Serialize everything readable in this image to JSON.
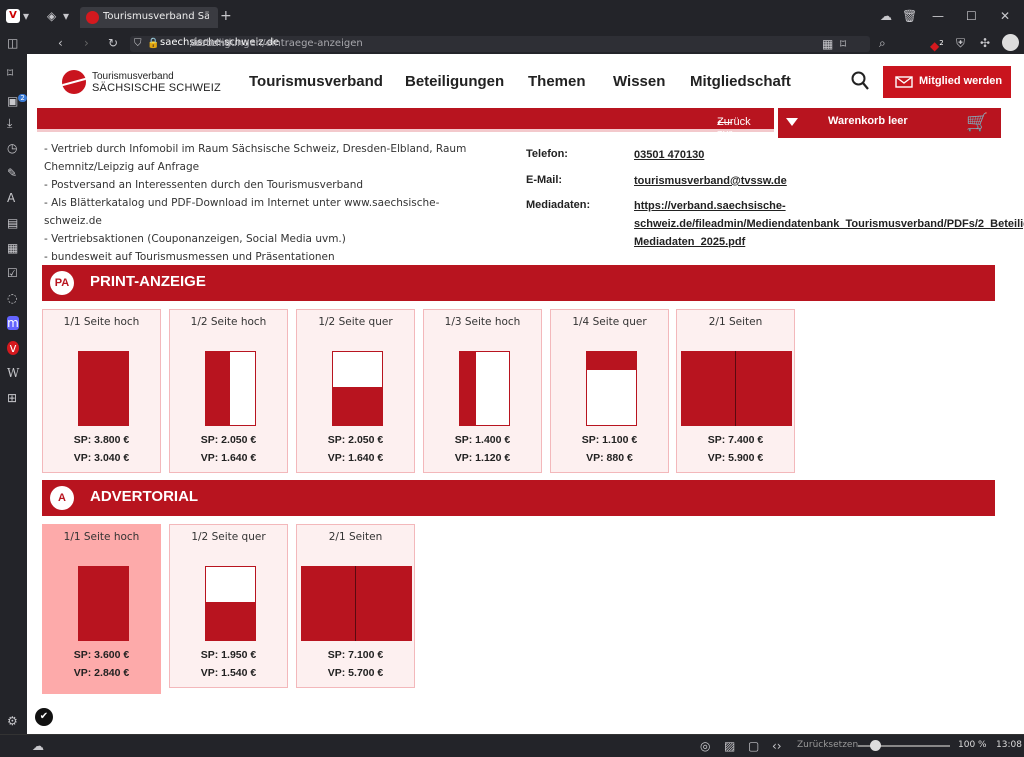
{
  "browser": {
    "tab_title": "Tourismusverband Sächsische",
    "url_pre": "verband.",
    "url_host": "saechsische-schweiz.de",
    "url_path": "/beteiligungen/eintraege-anzeigen",
    "sidebar_badge": "2",
    "ext_badge": "2",
    "status_reset": "Zurücksetzen",
    "zoom": "100 %",
    "clock": "13:08"
  },
  "header": {
    "logo_line1": "Tourismusverband",
    "logo_line2": "SÄCHSISCHE SCHWEIZ",
    "nav": [
      "Tourismusverband",
      "Beteiligungen",
      "Themen",
      "Wissen",
      "Mitgliedschaft"
    ],
    "cta": "Mitglied werden"
  },
  "back_label": "Zurück zur Liste",
  "cart_label": "Warenkorb leer",
  "bullets": [
    "- Vertrieb durch Infomobil im Raum Sächsische Schweiz, Dresden-Elbland,  Raum Chemnitz/Leipzig auf Anfrage",
    "- Postversand an Interessenten durch den Tourismusverband",
    "- Als Blätterkatalog und PDF-Download im Internet unter www.saechsische-schweiz.de",
    "- Vertriebsaktionen (Couponanzeigen, Social Media uvm.)",
    "- bundesweit auf Tourismusmessen und Präsentationen"
  ],
  "contact": {
    "phone_label": "Telefon:",
    "phone": "03501 470130",
    "email_label": "E-Mail:",
    "email": "tourismusverband@tvssw.de",
    "media_label": "Mediadaten:",
    "media_lines": [
      "https://verband.saechsische-",
      "schweiz.de/fileadmin/Mediendatenbank_Tourismusverband/PDFs/2_Beteilig",
      "Mediadaten_2025.pdf"
    ]
  },
  "print": {
    "badge": "PA",
    "title": "PRINT-ANZEIGE",
    "cards": [
      {
        "title": "1/1 Seite hoch",
        "sp": "SP: 3.800 €",
        "vp": "VP: 3.040 €"
      },
      {
        "title": "1/2 Seite hoch",
        "sp": "SP: 2.050 €",
        "vp": "VP: 1.640 €"
      },
      {
        "title": "1/2 Seite quer",
        "sp": "SP: 2.050 €",
        "vp": "VP: 1.640 €"
      },
      {
        "title": "1/3 Seite hoch",
        "sp": "SP: 1.400 €",
        "vp": "VP: 1.120 €"
      },
      {
        "title": "1/4 Seite quer",
        "sp": "SP: 1.100 €",
        "vp": "VP: 880 €"
      },
      {
        "title": "2/1 Seiten",
        "sp": "SP: 7.400 €",
        "vp": "VP: 5.900 €"
      }
    ]
  },
  "advertorial": {
    "badge": "A",
    "title": "ADVERTORIAL",
    "cards": [
      {
        "title": "1/1 Seite hoch",
        "sp": "SP: 3.600 €",
        "vp": "VP: 2.840 €"
      },
      {
        "title": "1/2 Seite quer",
        "sp": "SP: 1.950 €",
        "vp": "VP: 1.540 €"
      },
      {
        "title": "2/1 Seiten",
        "sp": "SP: 7.100 €",
        "vp": "VP: 5.700 €"
      }
    ]
  },
  "colors": {
    "brand": "#b8141f",
    "card_bg": "#fdf0f0",
    "card_hover": "#fdaaaa"
  }
}
